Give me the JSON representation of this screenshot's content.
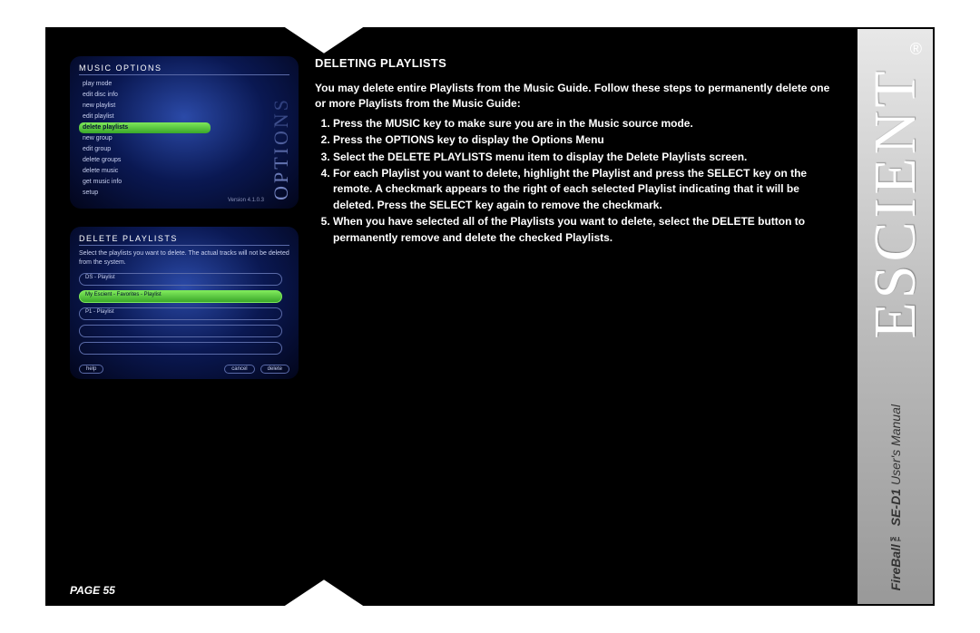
{
  "brand": "ESCIENT",
  "registered_mark": "®",
  "manual_label_product": "FireBall™ SE-D1",
  "manual_label_suffix": "User's Manual",
  "page_label": "PAGE 55",
  "section_title": "DELETING PLAYLISTS",
  "intro": "You may delete entire Playlists from the Music Guide. Follow these steps to permanently delete one or more Playlists from the Music Guide:",
  "steps": [
    "Press the MUSIC key to make sure you are in the Music source mode.",
    "Press the OPTIONS key to display the Options Menu",
    "Select the DELETE PLAYLISTS menu item to display the Delete Playlists screen.",
    "For each Playlist you want to delete, highlight the Playlist and press the SELECT key on the remote. A checkmark appears to the right of each selected Playlist indicating that it will be deleted. Press the SELECT key again to remove the checkmark.",
    "When you have selected all of the Playlists you want to delete, select the DELETE button to permanently remove and delete the checked Playlists."
  ],
  "shot1": {
    "title": "MUSIC OPTIONS",
    "side_label": "OPTIONS",
    "items": [
      "play mode",
      "edit disc info",
      "new playlist",
      "edit playlist",
      "delete playlists",
      "new group",
      "edit group",
      "delete groups",
      "delete music",
      "get music info",
      "setup"
    ],
    "selected_index": 4,
    "version": "Version 4.1.0.3"
  },
  "shot2": {
    "title": "DELETE PLAYLISTS",
    "desc": "Select the playlists you want to delete. The actual tracks will not be deleted from the system.",
    "rows": [
      "DS - Playlist",
      "My Escient - Favorites - Playlist",
      "P1 - Playlist",
      "",
      ""
    ],
    "selected_index": 1,
    "buttons": {
      "help": "help",
      "cancel": "cancel",
      "delete": "delete"
    }
  }
}
